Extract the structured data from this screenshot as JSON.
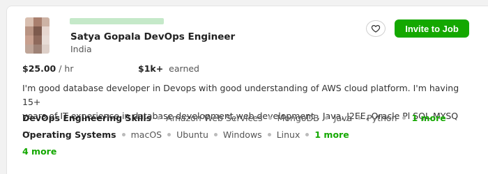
{
  "freelancer": {
    "title": "Satya Gopala DevOps Engineer",
    "location": "India",
    "rate_amount": "$25.00",
    "rate_unit": "/ hr",
    "earned_amount": "$1k+",
    "earned_label": "earned",
    "description_line1": "I'm good database developer in Devops with good understanding of AWS cloud platform. I'm having 15+",
    "description_line2": "years of IT experience in database development,web development , Java, J2EE, Oracle Pl SQL,MYSQ ..."
  },
  "actions": {
    "invite_label": "Invite to Job",
    "save_icon": "heart-icon"
  },
  "skills": [
    {
      "category": "DevOps Engineering Skills",
      "items": [
        "Amazon Web Services",
        "MongoDB",
        "Java",
        "Python"
      ],
      "more": "1 more"
    },
    {
      "category": "Operating Systems",
      "items": [
        "macOS",
        "Ubuntu",
        "Windows",
        "Linux"
      ],
      "more": "1 more"
    }
  ],
  "extra_more": "4 more",
  "colors": {
    "accent": "#14a800",
    "blur": "#b6e3bc"
  }
}
